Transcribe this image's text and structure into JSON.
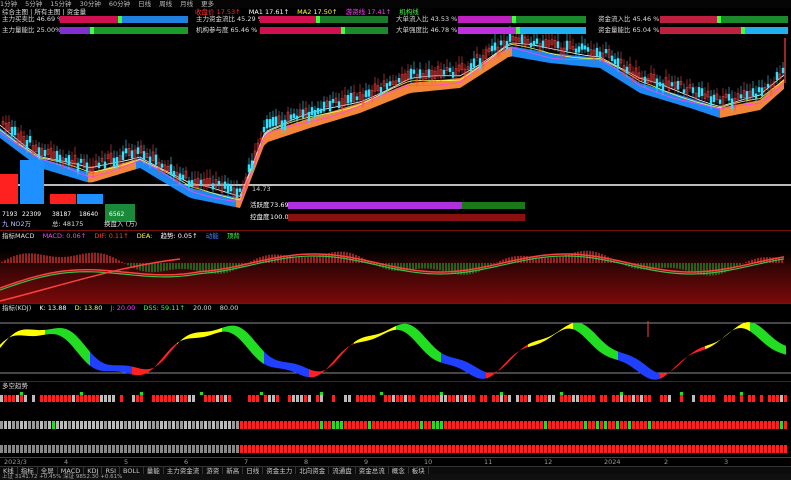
{
  "toolbar": {
    "items": [
      "1分钟",
      "5分钟",
      "15分钟",
      "30分钟",
      "60分钟",
      "日线",
      "周线",
      "月线",
      "更多"
    ]
  },
  "title": {
    "left_label": "综合主图 | 所有主图 | 资金量",
    "close_label": "收盘价",
    "close_value": "17.53↑",
    "ma1_label": "MA1",
    "ma1_value": "17.61↑",
    "ma2_label": "MA2",
    "ma2_value": "17.50↑",
    "ma3_label": "游资线",
    "ma3_value": "17.41↑",
    "extra_label": "机构线"
  },
  "indicators": [
    {
      "label": "主力买卖比",
      "value": "46.69 %买"
    },
    {
      "label": "主力资金流比",
      "value": "45.29 %"
    },
    {
      "label": "大单流入比",
      "value": "43.53 %买"
    },
    {
      "label": "资金流入比",
      "value": "45.46 %"
    },
    {
      "label": "主力量能比",
      "value": "25.00%买"
    },
    {
      "label": "机构参与度",
      "value": "65.46 %"
    },
    {
      "label": "大单强度比",
      "value": "46.78 %买"
    },
    {
      "label": "资金量能比",
      "value": "65.04 %"
    }
  ],
  "price_line_label": "14.73",
  "gauges": [
    {
      "label": "活跃度",
      "value": "73.69 %"
    },
    {
      "label": "控盘度",
      "value": "100.00 %"
    }
  ],
  "left_boxes": {
    "values": [
      "7193",
      "22309",
      "38187",
      "18640",
      "6562"
    ],
    "caption1": "九 NO2万",
    "caption2": "总: 48175",
    "caption3": "换盘入 (万)"
  },
  "macd": {
    "title": "指标MACD",
    "label1": "MACD: 0.06↑",
    "label2": "DIF: 0.11↑",
    "label3": "DEA:",
    "label4": "趋势: 0.05↑",
    "label5": "动能",
    "label6": "顶背"
  },
  "kdj": {
    "title": "指标(KDJ)",
    "k_label": "K: 13.88",
    "d_label": "D: 13.80",
    "j_label": "J: 20.00",
    "oth1": "DSS: 59.11↑",
    "oth2": "20.00",
    "oth3": "80.00"
  },
  "flow": {
    "title": "多空趋势",
    "rows": 4
  },
  "xaxis": {
    "ticks": [
      "2023/3",
      "4",
      "5",
      "6",
      "7",
      "8",
      "9",
      "10",
      "11",
      "12",
      "2024",
      "2",
      "3"
    ]
  },
  "tabs": [
    "K线",
    "指标",
    "全屏",
    "MACD",
    "KDJ",
    "RSI",
    "BOLL",
    "量能",
    "主力资金流",
    "游资",
    "新高",
    "日线",
    "资金主力",
    "北向资金",
    "流通盘",
    "资金总流",
    "概念",
    "板块"
  ],
  "status": {
    "text": "上证 3141.72 +0.45%  深证 9852.30 +0.61%"
  },
  "colors": {
    "up": "#ff2020",
    "down": "#00e0ff",
    "cloud_up": "#ff8c3a",
    "cloud_down": "#1e90ff",
    "green": "#22cc22",
    "yellow": "#ffff00",
    "blue": "#1e3cff"
  }
}
